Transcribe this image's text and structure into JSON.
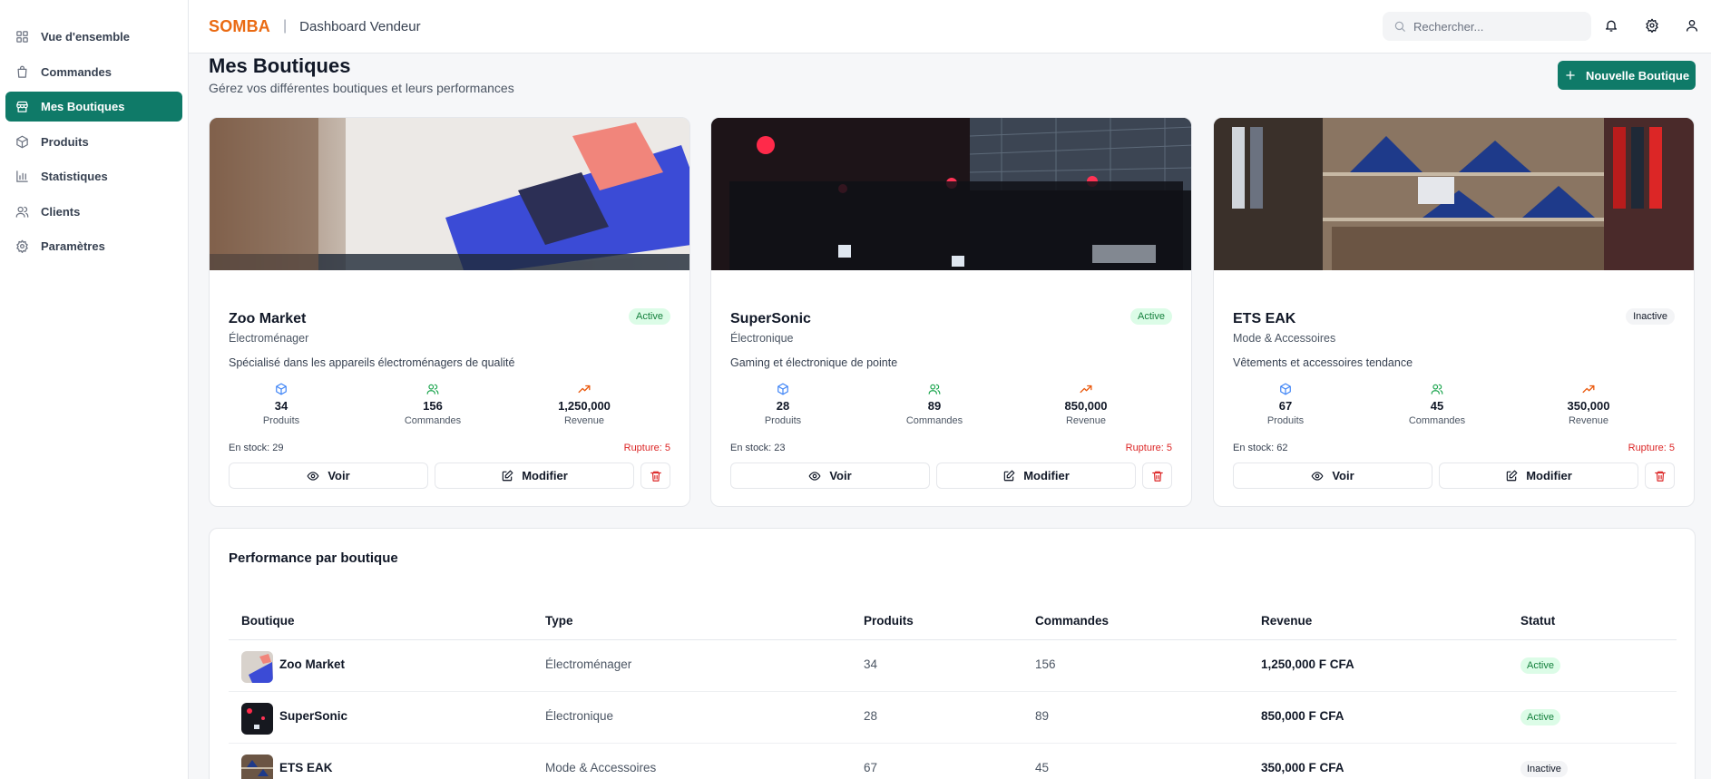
{
  "sidebar": {
    "items": [
      {
        "label": "Vue d'ensemble",
        "icon": "grid-icon"
      },
      {
        "label": "Commandes",
        "icon": "bag-icon"
      },
      {
        "label": "Mes Boutiques",
        "icon": "store-icon",
        "active": true
      },
      {
        "label": "Produits",
        "icon": "box-icon"
      },
      {
        "label": "Statistiques",
        "icon": "bar-chart-icon"
      },
      {
        "label": "Clients",
        "icon": "users-icon"
      },
      {
        "label": "Paramètres",
        "icon": "gear-icon"
      }
    ]
  },
  "header": {
    "brand": "SOMBA",
    "separator": "|",
    "subtitle": "Dashboard Vendeur",
    "search_placeholder": "Rechercher...",
    "icons": [
      "bell-icon",
      "gear-icon",
      "user-icon"
    ]
  },
  "main": {
    "title": "Mes Boutiques",
    "subtitle": "Gérez vos différentes boutiques et leurs performances",
    "new_button": "Nouvelle Boutique"
  },
  "labels": {
    "produits": "Produits",
    "commandes": "Commandes",
    "revenue": "Revenue",
    "voir": "Voir",
    "modifier": "Modifier"
  },
  "shops": [
    {
      "name": "Zoo Market",
      "type": "Électroménager",
      "description": "Spécialisé dans les appareils électroménagers de qualité",
      "status": "Active",
      "produits": "34",
      "commandes": "156",
      "revenue": "1,250,000",
      "stock": "En stock: 29",
      "rupture": "Rupture: 5"
    },
    {
      "name": "SuperSonic",
      "type": "Électronique",
      "description": "Gaming et électronique de pointe",
      "status": "Active",
      "produits": "28",
      "commandes": "89",
      "revenue": "850,000",
      "stock": "En stock: 23",
      "rupture": "Rupture: 5"
    },
    {
      "name": "ETS EAK",
      "type": "Mode & Accessoires",
      "description": "Vêtements et accessoires tendance",
      "status": "Inactive",
      "produits": "67",
      "commandes": "45",
      "revenue": "350,000",
      "stock": "En stock: 62",
      "rupture": "Rupture: 5"
    }
  ],
  "table": {
    "title": "Performance par boutique",
    "headers": [
      "Boutique",
      "Type",
      "Produits",
      "Commandes",
      "Revenue",
      "Statut"
    ],
    "rows": [
      {
        "boutique": "Zoo Market",
        "type": "Électroménager",
        "produits": "34",
        "commandes": "156",
        "revenue": "1,250,000 F CFA",
        "statut": "Active"
      },
      {
        "boutique": "SuperSonic",
        "type": "Électronique",
        "produits": "28",
        "commandes": "89",
        "revenue": "850,000 F CFA",
        "statut": "Active"
      },
      {
        "boutique": "ETS EAK",
        "type": "Mode & Accessoires",
        "produits": "67",
        "commandes": "45",
        "revenue": "350,000 F CFA",
        "statut": "Inactive"
      }
    ]
  },
  "colors": {
    "accent": "#0f7a68",
    "brand": "#ea6a12",
    "danger": "#dc2626",
    "active_bg": "#dcfce7",
    "active_text": "#15803d"
  }
}
